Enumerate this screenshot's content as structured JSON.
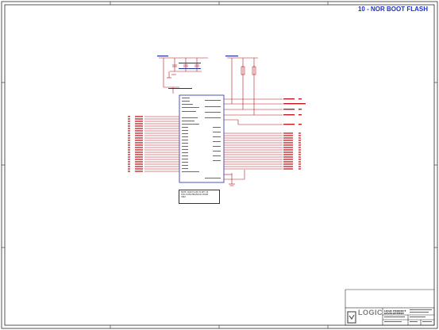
{
  "sheet": {
    "title": "10 - NOR BOOT FLASH",
    "note_lines": [
      "NOTE: NOR FLASH IS SET UP",
      "FOR ASYNCHRONOUS MODE",
      "ONLY"
    ],
    "logo_text": "LOGIC",
    "title_block": [
      "LOGIC PRODUCT",
      "DEVELOPMENT"
    ]
  },
  "colors": {
    "wire": "#b5161c",
    "border": "#2a2a2a",
    "chip_outline": "#1f2da8",
    "title": "#1d2fd0",
    "label": "#c1191f"
  },
  "schematic": {
    "chip_count": 1,
    "left_bus_lines": 24,
    "right_bus_lines": 16
  }
}
